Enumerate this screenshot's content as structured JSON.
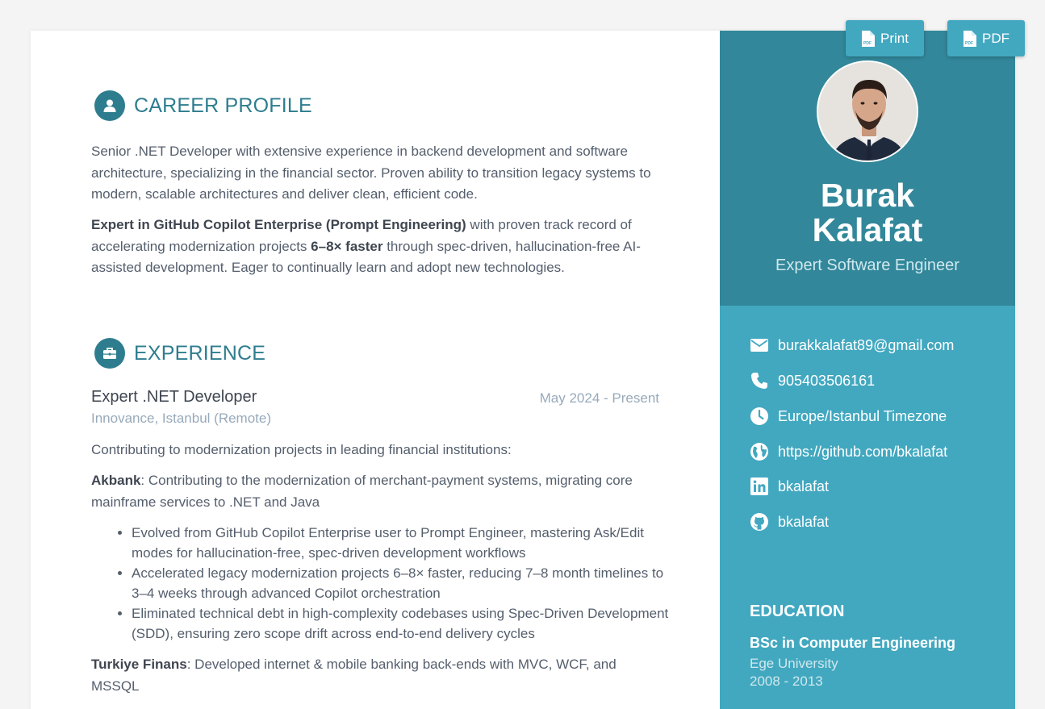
{
  "toolbar": {
    "print_label": "Print",
    "pdf_label": "PDF",
    "print_icon": "pdf-file-icon",
    "pdf_icon": "pdf-file-icon"
  },
  "profile": {
    "name_line1": "Burak",
    "name_line2": "Kalafat",
    "role": "Expert Software Engineer",
    "avatar_icon": "profile-photo"
  },
  "contacts": [
    {
      "icon": "envelope-icon",
      "text": "burakkalafat89@gmail.com"
    },
    {
      "icon": "phone-icon",
      "text": "905403506161"
    },
    {
      "icon": "clock-icon",
      "text": "Europe/Istanbul Timezone"
    },
    {
      "icon": "globe-icon",
      "text": "https://github.com/bkalafat"
    },
    {
      "icon": "linkedin-icon",
      "text": "bkalafat"
    },
    {
      "icon": "github-icon",
      "text": "bkalafat"
    }
  ],
  "education": {
    "title": "EDUCATION",
    "degree": "BSc in Computer Engineering",
    "school": "Ege University",
    "years": "2008 - 2013"
  },
  "career_profile": {
    "title": "CAREER PROFILE",
    "icon": "user-icon",
    "paragraph1": "Senior .NET Developer with extensive experience in backend development and software architecture, specializing in the financial sector. Proven ability to transition legacy systems to modern, scalable architectures and deliver clean, efficient code.",
    "p2_bold1": "Expert in GitHub Copilot Enterprise (Prompt Engineering)",
    "p2_text1": " with proven track record of accelerating modernization projects ",
    "p2_bold2": "6–8× faster",
    "p2_text2": " through spec-driven, hallucination-free AI-assisted development. Eager to continually learn and adopt new technologies."
  },
  "experience": {
    "title": "EXPERIENCE",
    "icon": "briefcase-icon",
    "job_title": "Expert .NET Developer",
    "job_date": "May 2024 - Present",
    "company": "Innovance, Istanbul (Remote)",
    "intro": "Contributing to modernization projects in leading financial institutions:",
    "akbank_bold": "Akbank",
    "akbank_text": ": Contributing to the modernization of merchant-payment systems, migrating core mainframe services to .NET and Java",
    "bullets": [
      "Evolved from GitHub Copilot Enterprise user to Prompt Engineer, mastering Ask/Edit modes for hallucination-free, spec-driven development workflows",
      "Accelerated legacy modernization projects 6–8× faster, reducing 7–8 month timelines to 3–4 weeks through advanced Copilot orchestration",
      "Eliminated technical debt in high-complexity codebases using Spec-Driven Development (SDD), ensuring zero scope drift across end-to-end delivery cycles"
    ],
    "tf_bold": "Turkiye Finans",
    "tf_text": ": Developed internet & mobile banking back-ends with MVC, WCF, and MSSQL"
  },
  "colors": {
    "accent": "#2e7d8f",
    "sidebar": "#42a8c0",
    "sidebar_header": "#32879a",
    "muted": "#97aaba",
    "text": "#545e6c"
  }
}
